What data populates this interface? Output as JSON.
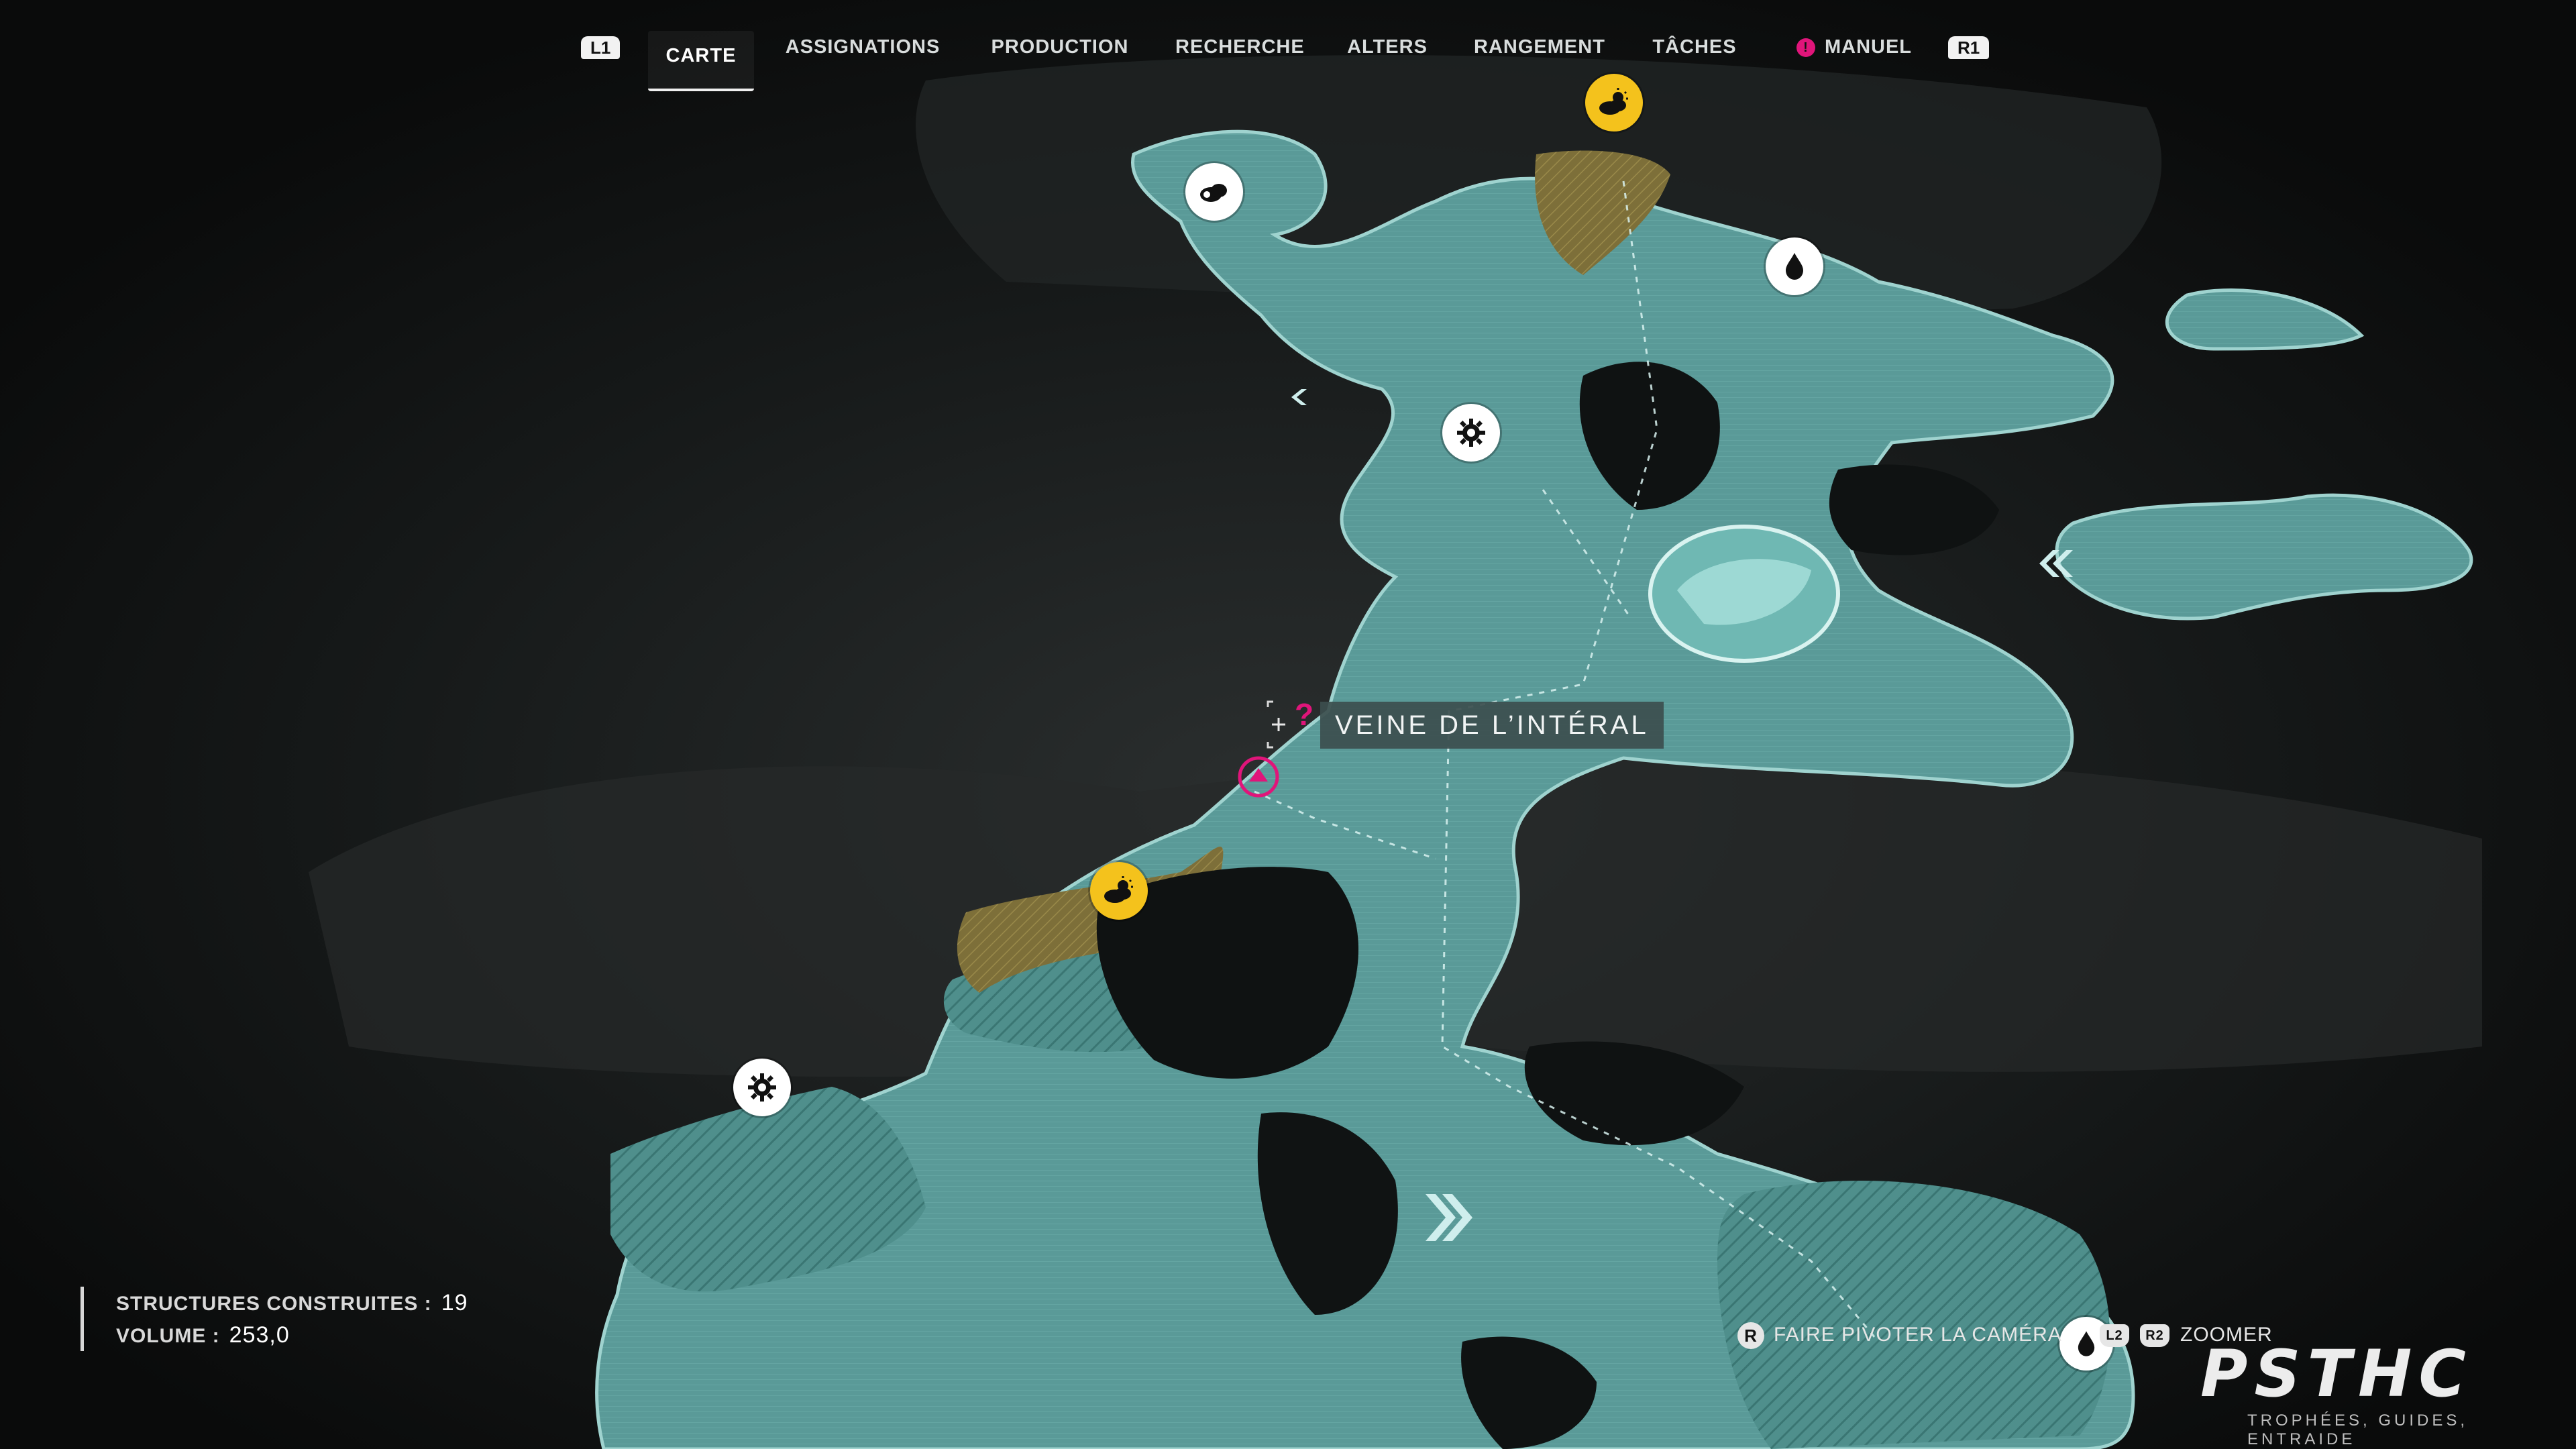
{
  "nav": {
    "left_trigger": "L1",
    "right_trigger": "R1",
    "tabs": [
      {
        "label": "CARTE",
        "active": true
      },
      {
        "label": "ASSIGNATIONS",
        "active": false
      },
      {
        "label": "PRODUCTION",
        "active": false
      },
      {
        "label": "RECHERCHE",
        "active": false
      },
      {
        "label": "ALTERS",
        "active": false
      },
      {
        "label": "RANGEMENT",
        "active": false
      },
      {
        "label": "TÂCHES",
        "active": false
      },
      {
        "label": "MANUEL",
        "active": false,
        "alert_badge": "!"
      }
    ]
  },
  "stats": {
    "structures_label": "STRUCTURES CONSTRUITES :",
    "structures_value": "19",
    "volume_label": "VOLUME :",
    "volume_value": "253,0"
  },
  "location": {
    "name": "VEINE DE L’INTÉRAL",
    "marker_symbol": "?"
  },
  "map_icons": [
    {
      "name": "cloud-resource-icon",
      "style": "white"
    },
    {
      "name": "sun-cloud-resource-icon",
      "style": "yellow"
    },
    {
      "name": "water-drop-icon",
      "style": "white"
    },
    {
      "name": "gear-structure-icon",
      "style": "white"
    },
    {
      "name": "sun-cloud-resource-icon",
      "style": "yellow"
    },
    {
      "name": "gear-structure-icon",
      "style": "white"
    },
    {
      "name": "water-drop-icon",
      "style": "white"
    }
  ],
  "controls": {
    "rotate_key": "R",
    "rotate_label": "FAIRE PIVOTER LA CAMÉRA",
    "l2_key": "L2",
    "r2_key": "R2",
    "zoom_label": "ZOOMER"
  },
  "watermark": {
    "logo": "PSTHC",
    "tagline": "TROPHÉES, GUIDES, ENTRAIDE"
  },
  "colors": {
    "land": "#5a9a98",
    "land_hatch": "#3f7f7c",
    "land_edge": "#9fd3cf",
    "ochre_zone": "#8a7a3c",
    "yellow_icon": "#f4c21c",
    "magenta": "#e0157a",
    "background": "#0b0d0d"
  }
}
